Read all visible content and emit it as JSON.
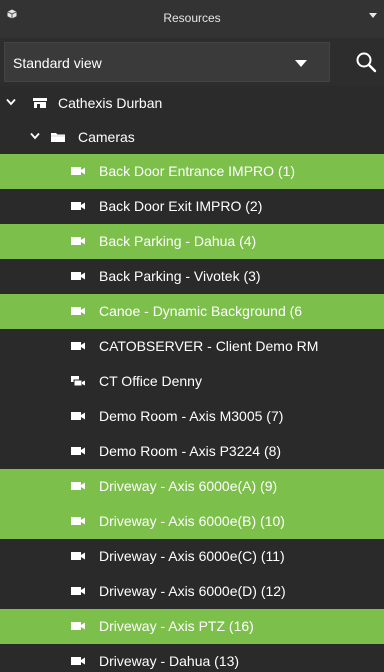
{
  "panel": {
    "title": "Resources",
    "icon": "resources-icon",
    "collapse_icon": "chevron-down-icon"
  },
  "view": {
    "selected": "Standard view",
    "search_icon": "search-icon"
  },
  "tree": {
    "site": {
      "label": "Cathexis Durban",
      "expanded": true,
      "icon": "server-icon"
    },
    "folder": {
      "label": "Cameras",
      "expanded": true,
      "icon": "folder-icon"
    },
    "cameras": [
      {
        "label": "Back Door Entrance IMPRO (1)",
        "selected": true,
        "icon": "camera-icon"
      },
      {
        "label": "Back Door Exit IMPRO (2)",
        "selected": false,
        "icon": "camera-icon"
      },
      {
        "label": "Back Parking - Dahua (4)",
        "selected": true,
        "icon": "camera-icon"
      },
      {
        "label": "Back Parking - Vivotek (3)",
        "selected": false,
        "icon": "camera-icon"
      },
      {
        "label": "Canoe - Dynamic Background (6",
        "selected": true,
        "icon": "camera-icon"
      },
      {
        "label": "CATOBSERVER - Client Demo RM",
        "selected": false,
        "icon": "camera-icon"
      },
      {
        "label": "CT Office Denny",
        "selected": false,
        "icon": "camera-group-icon"
      },
      {
        "label": "Demo Room - Axis M3005 (7)",
        "selected": false,
        "icon": "camera-icon"
      },
      {
        "label": "Demo Room - Axis P3224 (8)",
        "selected": false,
        "icon": "camera-icon"
      },
      {
        "label": "Driveway - Axis 6000e(A) (9)",
        "selected": true,
        "icon": "camera-icon"
      },
      {
        "label": "Driveway - Axis 6000e(B) (10)",
        "selected": true,
        "icon": "camera-icon"
      },
      {
        "label": "Driveway - Axis 6000e(C) (11)",
        "selected": false,
        "icon": "camera-icon"
      },
      {
        "label": "Driveway - Axis 6000e(D) (12)",
        "selected": false,
        "icon": "camera-icon"
      },
      {
        "label": "Driveway - Axis PTZ (16)",
        "selected": true,
        "icon": "camera-icon"
      },
      {
        "label": "Driveway - Dahua (13)",
        "selected": false,
        "icon": "camera-icon"
      }
    ]
  },
  "colors": {
    "selected_bg": "#7cc04b",
    "row_bg": "#2a2a2a",
    "panel_bg": "#2b2b2b"
  }
}
